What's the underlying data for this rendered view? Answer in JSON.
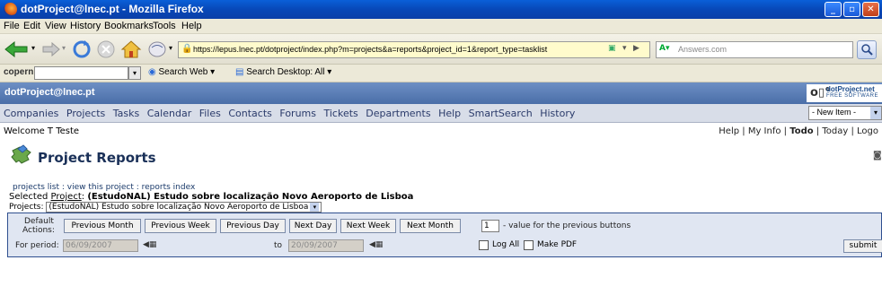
{
  "window": {
    "title": "dotProject@lnec.pt - Mozilla Firefox"
  },
  "menu": [
    "File",
    "Edit",
    "View",
    "History",
    "Bookmarks",
    "Tools",
    "Help"
  ],
  "browser": {
    "url": "https://lepus.lnec.pt/dotproject/index.php?m=projects&a=reports&project_id=1&report_type=tasklist",
    "search_placeholder": "Answers.com"
  },
  "copernic": {
    "label": "copernic",
    "search_web": "Search Web",
    "search_desktop": "Search Desktop: All"
  },
  "app": {
    "brand": "dotProject@lnec.pt",
    "logo_line1": "dotProject.net",
    "logo_line2": "FREE SOFTWARE",
    "nav": [
      "Companies",
      "Projects",
      "Tasks",
      "Calendar",
      "Files",
      "Contacts",
      "Forums",
      "Tickets",
      "Departments",
      "Help",
      "SmartSearch",
      "History"
    ],
    "new_item": "- New Item -",
    "welcome": "Welcome T Teste",
    "user_links": {
      "help": "Help",
      "sep1": " | ",
      "my_info": "My Info",
      "sep2": " | ",
      "todo": "Todo",
      "sep3": " | ",
      "today": "Today",
      "sep4": " | ",
      "logout": "Logo"
    }
  },
  "page": {
    "title": "Project Reports",
    "breadcrumbs": "projects list : view this project : reports index",
    "selected_label": "Selected ",
    "selected_project_word": "Project",
    "selected_colon": ": ",
    "selected_name": "(EstudoNAL) Estudo sobre localização Novo Aeroporto de Lisboa",
    "projects_label": "Projects: ",
    "projects_value": "(EstudoNAL) Estudo sobre localização Novo Aeroporto de Lisboa"
  },
  "form": {
    "default_actions_label_1": "Default",
    "default_actions_label_2": "Actions:",
    "buttons": [
      "Previous Month",
      "Previous Week",
      "Previous Day",
      "Next Day",
      "Next Week",
      "Next Month"
    ],
    "value_field": "1",
    "value_help": "- value for the previous buttons",
    "for_period_label": "For period:",
    "from_date": "06/09/2007",
    "to_label": "to",
    "to_date": "20/09/2007",
    "log_all_label": "Log All",
    "make_pdf_label": "Make PDF",
    "submit_label": "submit"
  }
}
